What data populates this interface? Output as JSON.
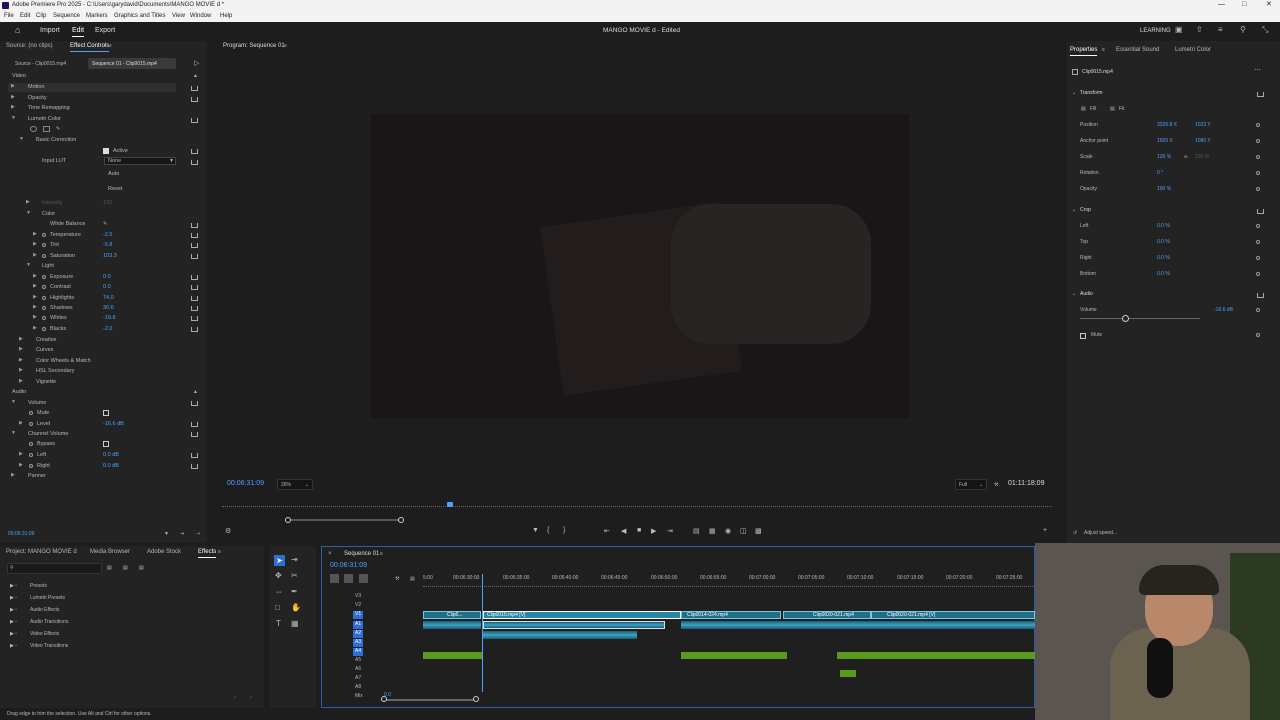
{
  "window": {
    "title": "Adobe Premiere Pro 2025 - C:\\Users\\garydavid\\Documents\\MANGO MOVIE d *"
  },
  "menu": [
    "File",
    "Edit",
    "Clip",
    "Sequence",
    "Markers",
    "Graphics and Titles",
    "View",
    "Window",
    "Help"
  ],
  "header": {
    "tabs": [
      "Import",
      "Edit",
      "Export"
    ],
    "active": "Edit",
    "project_title": "MANGO MOVIE d - Edited",
    "workspace": "LEARNING"
  },
  "effect_controls": {
    "tabs": [
      "Source: (no clips)",
      "Effect Controls"
    ],
    "source_tab": "Source - Clip0015.mp4",
    "sequence_tab": "Sequence 01 - Clip0015.mp4",
    "sections": {
      "video": "Video",
      "audio": "Audio"
    },
    "effects": [
      "Motion",
      "Opacity",
      "Time Remapping",
      "Lumetri Color"
    ],
    "basic_correction": "Basic Correction",
    "active_label": "Active",
    "input_lut_label": "Input LUT",
    "input_lut_value": "None",
    "auto_btn": "Auto",
    "reset_btn": "Reset",
    "intensity": "Intensity",
    "intensity_value": "100",
    "color_label": "Color",
    "white_balance": "White Balance",
    "color_props": [
      {
        "name": "Temperature",
        "value": "-2.5"
      },
      {
        "name": "Tint",
        "value": "-5.8"
      },
      {
        "name": "Saturation",
        "value": "103.3"
      }
    ],
    "light_label": "Light",
    "light_props": [
      {
        "name": "Exposure",
        "value": "0.0"
      },
      {
        "name": "Contrast",
        "value": "0.0"
      },
      {
        "name": "Highlights",
        "value": "74.0"
      },
      {
        "name": "Shadows",
        "value": "30.6"
      },
      {
        "name": "Whites",
        "value": "-19.8"
      },
      {
        "name": "Blacks",
        "value": "-2.0"
      }
    ],
    "lumetri_subs": [
      "Creative",
      "Curves",
      "Color Wheels & Match",
      "HSL Secondary",
      "Vignette"
    ],
    "volume": "Volume",
    "mute": "Mute",
    "level": "Level",
    "level_value": "-16.6 dB",
    "channel_volume": "Channel Volume",
    "bypass": "Bypass",
    "left": "Left",
    "left_value": "0.0 dB",
    "right": "Right",
    "right_value": "0.0 dB",
    "panner": "Panner",
    "timecode": "00:06:31:09"
  },
  "program": {
    "title": "Program: Sequence 01",
    "timecode": "00:06:31:09",
    "zoom": "26%",
    "quality": "Full",
    "duration": "01:11:18:09"
  },
  "properties": {
    "tabs": [
      "Properties",
      "Essential Sound",
      "Lumetri Color"
    ],
    "clip": "Clip0015.mp4",
    "transform": "Transform",
    "fill": "Fill",
    "fit": "Fit",
    "rows": [
      {
        "label": "Position",
        "v1": "3326.8 X",
        "v2": "1023 Y"
      },
      {
        "label": "Anchor point",
        "v1": "1920 X",
        "v2": "1080 Y"
      },
      {
        "label": "Scale",
        "v1": "126 %",
        "v2": "100 %"
      },
      {
        "label": "Rotation",
        "v1": "0 °",
        "v2": ""
      },
      {
        "label": "Opacity",
        "v1": "100 %",
        "v2": ""
      }
    ],
    "crop": "Crop",
    "crop_rows": [
      {
        "label": "Left",
        "v": "0.0 %"
      },
      {
        "label": "Top",
        "v": "0.0 %"
      },
      {
        "label": "Right",
        "v": "0.0 %"
      },
      {
        "label": "Bottom",
        "v": "0.0 %"
      }
    ],
    "audio": "Audio",
    "volume": "Volume",
    "volume_value": "-16.6 dB",
    "volume_level": 0.2,
    "mute": "Mute",
    "adjust_speed": "Adjust speed..."
  },
  "project": {
    "tabs": [
      "Project: MANGO MOVIE d",
      "Media Browser",
      "Adobe Stock",
      "Effects"
    ],
    "items": [
      "Presets",
      "Lumetri Presets",
      "Audio Effects",
      "Audio Transitions",
      "Video Effects",
      "Video Transitions"
    ]
  },
  "timeline": {
    "tab": "Sequence 01",
    "timecode": "00:06:31:09",
    "ruler": [
      "5:00",
      "00:06:30:00",
      "00:06:35:00",
      "00:06:40:00",
      "00:06:45:00",
      "00:06:50:00",
      "00:06:55:00",
      "00:07:00:00",
      "00:07:05:00",
      "00:07:10:00",
      "00:07:15:00",
      "00:07:20:00",
      "00:07:25:00"
    ],
    "tracks": [
      "V3",
      "V2",
      "V1",
      "A1",
      "A2",
      "A3",
      "A4",
      "A5",
      "A6",
      "A7",
      "A8",
      "Mix"
    ],
    "clips": [
      "Clip0...",
      "Clip0015.mp4 [V]",
      "Clip0014-024.mp4",
      "Clip0020-021.mp4",
      "Clip0020-021.mp4 [V]"
    ],
    "mix_value": "0.0"
  },
  "status": "Drag edge to trim the selection. Use Alt and Ctrl for other options."
}
